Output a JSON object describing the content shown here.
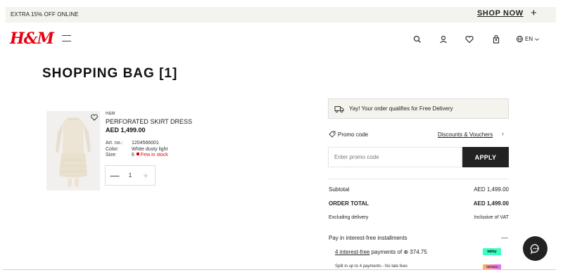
{
  "promo_bar": {
    "text": "EXTRA 15% OFF ONLINE",
    "cta": "SHOP NOW",
    "plus": "+"
  },
  "header": {
    "logo": "H&M",
    "language": "EN"
  },
  "page": {
    "title": "SHOPPING BAG [1]"
  },
  "item": {
    "brand": "H&M",
    "name": "PERFORATED SKIRT DRESS",
    "price": "AED 1,499.00",
    "art_label": "Art. no.:",
    "art_value": "1204566001",
    "color_label": "Color:",
    "color_value": "White dusty light",
    "size_label": "Size:",
    "size_value": "6",
    "stock": "Few in stock",
    "quantity": "1",
    "minus": "—",
    "plus": "+"
  },
  "summary": {
    "delivery_message": "Yay! Your order qualifies for Free Delivery",
    "promo_label": "Promo code",
    "discounts_link": "Discounts & Vouchers",
    "promo_placeholder": "Enter promo code",
    "apply_label": "APPLY",
    "subtotal_label": "Subtotal",
    "subtotal_value": "AED 1,499.00",
    "total_label": "ORDER TOTAL",
    "total_value": "AED 1,499.00",
    "delivery_label": "Excluding delivery",
    "vat_label": "Inclusive of VAT"
  },
  "installments": {
    "title": "Pay in interest-free installments",
    "line1_link": "4 interest-free",
    "line1_rest": " payments of ⊕ 374.75",
    "tabby": "tabby",
    "line2": "Split in up to 4 payments - No late fees",
    "tamara": "tamara"
  },
  "colors": {
    "accent": "#e50010",
    "dark": "#222222",
    "promo_bg": "#f4f3ee",
    "tabby": "#3bffc1"
  }
}
